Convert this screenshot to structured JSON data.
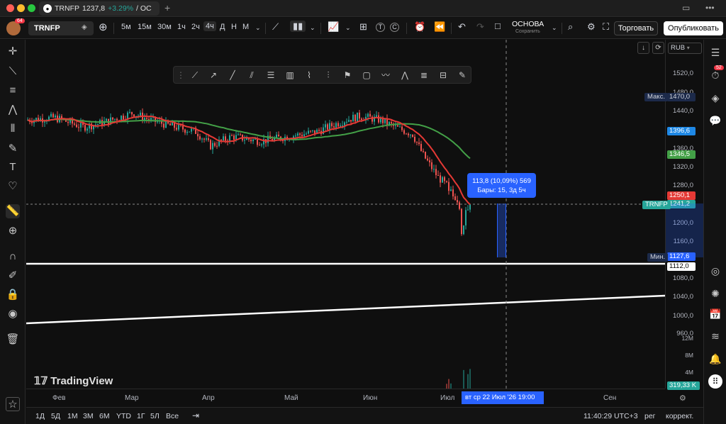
{
  "window": {
    "tab_title": "TRNFP",
    "tab_price": "1237,8",
    "tab_change": "+3.29%",
    "tab_suffix": "/ ОС"
  },
  "toolbar": {
    "symbol": "TRNFP",
    "avatar_badge": "64",
    "timeframes": [
      "5м",
      "15м",
      "30м",
      "1ч",
      "2ч",
      "4ч",
      "Д",
      "Н",
      "М"
    ],
    "active_timeframe": "4ч",
    "layout_name": "ОСНОВА",
    "layout_status": "Сохранить",
    "trade_label": "Торговать",
    "publish_label": "Опубликовать"
  },
  "chart": {
    "currency": "RUB",
    "watermark": "TradingView",
    "price_ticks": [
      "1520,0",
      "1480,0",
      "1440,0",
      "1360,0",
      "1320,0",
      "1280,0",
      "1200,0",
      "1160,0",
      "1080,0",
      "1040,0",
      "1000,0",
      "960,0"
    ],
    "volume_ticks": [
      "12M",
      "8M",
      "4M"
    ],
    "time_ticks": [
      "Фев",
      "Мар",
      "Апр",
      "Май",
      "Июн",
      "Июл",
      "Сен"
    ],
    "labels": {
      "max_label": "Макс.",
      "max_value": "1470,0",
      "min_label": "Мин.",
      "min_value": "1127,6",
      "price_1": "1396,6",
      "price_2": "1346,5",
      "price_red": "1250,1",
      "symbol_tag": "TRNFP",
      "last_price": "1241,2",
      "line_price": "1112,0",
      "volume_value": "319,33 K"
    },
    "measure": {
      "line1": "113,8 (10,09%) 569",
      "line2": "Бары: 15, 3д 5ч"
    },
    "cursor_date": "вт  ср 22 Июл '26   19:00",
    "colors": {
      "up": "#26a69a",
      "down": "#ef5350",
      "ma_fast": "#e53935",
      "ma_slow": "#43a047",
      "accent": "#2962ff"
    }
  },
  "bottom_bar": {
    "ranges": [
      "1Д",
      "5Д",
      "1М",
      "3М",
      "6М",
      "YTD",
      "1Г",
      "5Л",
      "Все"
    ],
    "time": "11:40:29 UTC+3",
    "session": "рег",
    "adjust": "коррект."
  },
  "right_bar": {
    "badge": "52"
  }
}
